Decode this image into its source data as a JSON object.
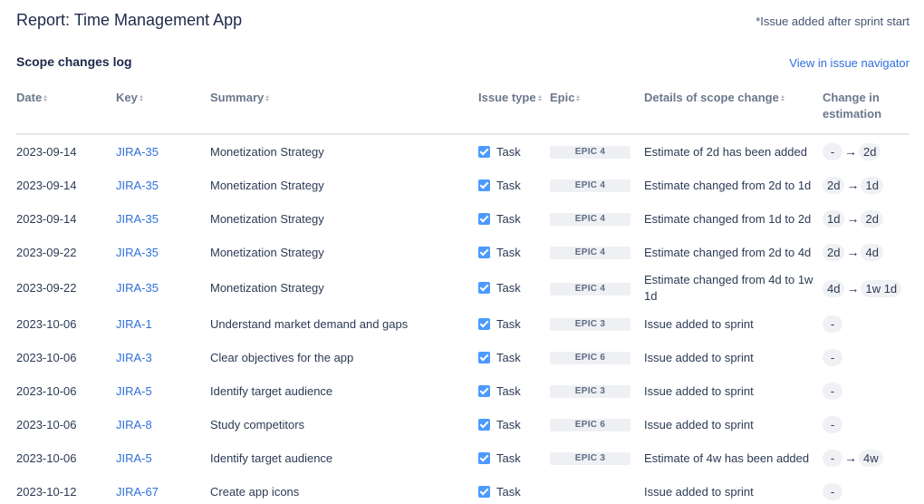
{
  "header": {
    "title": "Report: Time Management App",
    "footnote": "*Issue added after sprint start"
  },
  "section": {
    "title": "Scope changes log",
    "navigator_link": "View in issue navigator"
  },
  "table": {
    "columns": [
      {
        "label": "Date",
        "sortable": true
      },
      {
        "label": "Key",
        "sortable": true
      },
      {
        "label": "Summary",
        "sortable": true
      },
      {
        "label": "Issue type",
        "sortable": true
      },
      {
        "label": "Epic",
        "sortable": true
      },
      {
        "label": "Details of scope change",
        "sortable": true
      },
      {
        "label": "Change in estimation",
        "sortable": false
      }
    ],
    "rows": [
      {
        "date": "2023-09-14",
        "key": "JIRA-35",
        "summary": "Monetization Strategy",
        "issue_type": "Task",
        "issue_type_icon": "checkbox-icon",
        "epic": "EPIC 4",
        "details": "Estimate of 2d has been added",
        "from": "-",
        "to": "2d"
      },
      {
        "date": "2023-09-14",
        "key": "JIRA-35",
        "summary": "Monetization Strategy",
        "issue_type": "Task",
        "issue_type_icon": "checkbox-icon",
        "epic": "EPIC 4",
        "details": "Estimate changed from 2d to 1d",
        "from": "2d",
        "to": "1d"
      },
      {
        "date": "2023-09-14",
        "key": "JIRA-35",
        "summary": "Monetization Strategy",
        "issue_type": "Task",
        "issue_type_icon": "checkbox-icon",
        "epic": "EPIC 4",
        "details": "Estimate changed from 1d to 2d",
        "from": "1d",
        "to": "2d"
      },
      {
        "date": "2023-09-22",
        "key": "JIRA-35",
        "summary": "Monetization Strategy",
        "issue_type": "Task",
        "issue_type_icon": "checkbox-icon",
        "epic": "EPIC 4",
        "details": "Estimate changed from 2d to 4d",
        "from": "2d",
        "to": "4d"
      },
      {
        "date": "2023-09-22",
        "key": "JIRA-35",
        "summary": "Monetization Strategy",
        "issue_type": "Task",
        "issue_type_icon": "checkbox-icon",
        "epic": "EPIC 4",
        "details": "Estimate changed from 4d to 1w 1d",
        "from": "4d",
        "to": "1w 1d"
      },
      {
        "date": "2023-10-06",
        "key": "JIRA-1",
        "summary": "Understand market demand and gaps",
        "issue_type": "Task",
        "issue_type_icon": "checkbox-icon",
        "epic": "EPIC 3",
        "details": "Issue added to sprint",
        "from": "-",
        "to": null
      },
      {
        "date": "2023-10-06",
        "key": "JIRA-3",
        "summary": "Clear objectives for the app",
        "issue_type": "Task",
        "issue_type_icon": "checkbox-icon",
        "epic": "EPIC 6",
        "details": "Issue added to sprint",
        "from": "-",
        "to": null
      },
      {
        "date": "2023-10-06",
        "key": "JIRA-5",
        "summary": "Identify target audience",
        "issue_type": "Task",
        "issue_type_icon": "checkbox-icon",
        "epic": "EPIC 3",
        "details": "Issue added to sprint",
        "from": "-",
        "to": null
      },
      {
        "date": "2023-10-06",
        "key": "JIRA-8",
        "summary": "Study competitors",
        "issue_type": "Task",
        "issue_type_icon": "checkbox-icon",
        "epic": "EPIC 6",
        "details": "Issue added to sprint",
        "from": "-",
        "to": null
      },
      {
        "date": "2023-10-06",
        "key": "JIRA-5",
        "summary": "Identify target audience",
        "issue_type": "Task",
        "issue_type_icon": "checkbox-icon",
        "epic": "EPIC 3",
        "details": "Estimate of 4w has been added",
        "from": "-",
        "to": "4w"
      },
      {
        "date": "2023-10-12",
        "key": "JIRA-67",
        "summary": "Create app icons",
        "issue_type": "Task",
        "issue_type_icon": "checkbox-icon",
        "epic": null,
        "details": "Issue added to sprint",
        "from": "-",
        "to": null
      }
    ]
  },
  "colors": {
    "link": "#2f6fdc",
    "task_icon": "#4c9aff",
    "epic_badge_bg": "#eef0f3",
    "pill_bg": "#f0f1f4",
    "header_text": "#6b778c",
    "title_text": "#1d2a4a"
  }
}
